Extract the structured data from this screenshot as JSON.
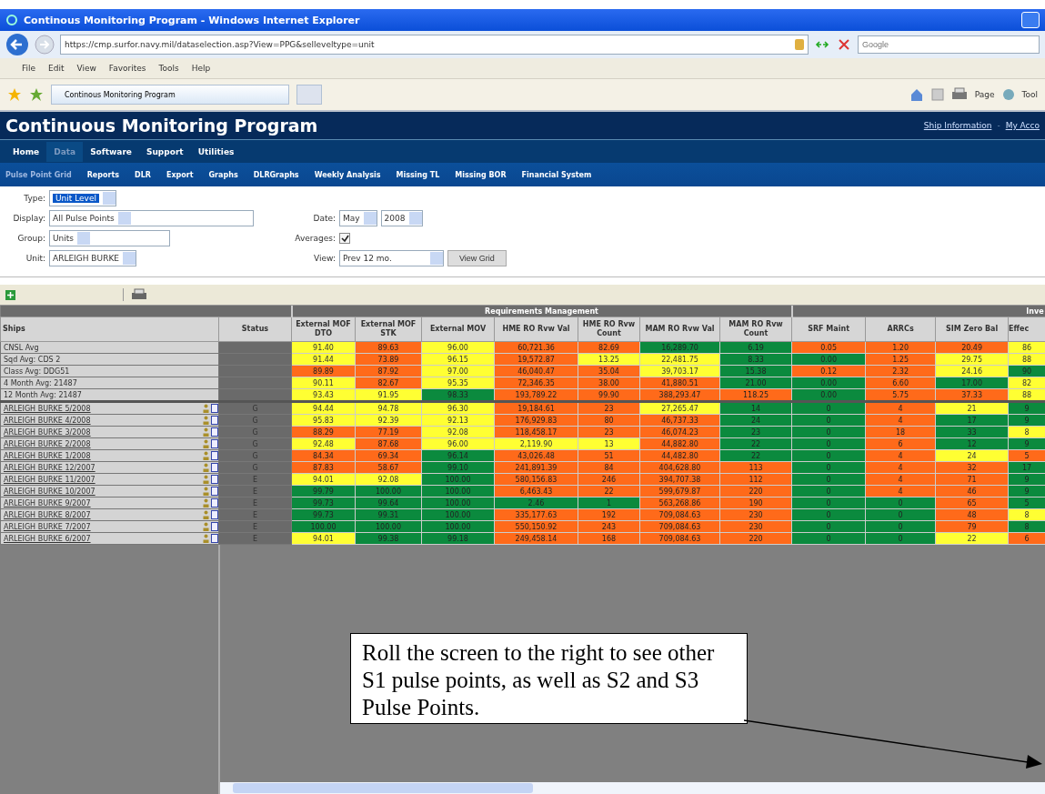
{
  "window": {
    "title": "Continous Monitoring Program - Windows Internet Explorer"
  },
  "address_bar": {
    "url": "https://cmp.surfor.navy.mil/dataselection.asp?View=PPG&selleveltype=unit"
  },
  "search": {
    "placeholder": "Google"
  },
  "menu_bar": [
    "File",
    "Edit",
    "View",
    "Favorites",
    "Tools",
    "Help"
  ],
  "browser_tab": {
    "title": "Continous Monitoring Program"
  },
  "command_bar": [
    "Page",
    "Tool"
  ],
  "app": {
    "title": "Continuous Monitoring Program",
    "header_links": [
      "Ship Information",
      "My Acco"
    ],
    "header_separator": "-"
  },
  "nav": [
    {
      "label": "Home",
      "selected": false
    },
    {
      "label": "Data",
      "selected": true
    },
    {
      "label": "Software",
      "selected": false
    },
    {
      "label": "Support",
      "selected": false
    },
    {
      "label": "Utilities",
      "selected": false
    }
  ],
  "subnav": [
    {
      "label": "Pulse Point Grid",
      "selected": true
    },
    {
      "label": "Reports",
      "selected": false
    },
    {
      "label": "DLR",
      "selected": false
    },
    {
      "label": "Export",
      "selected": false
    },
    {
      "label": "Graphs",
      "selected": false
    },
    {
      "label": "DLRGraphs",
      "selected": false
    },
    {
      "label": "Weekly Analysis",
      "selected": false
    },
    {
      "label": "Missing TL",
      "selected": false
    },
    {
      "label": "Missing BOR",
      "selected": false
    },
    {
      "label": "Financial System",
      "selected": false
    }
  ],
  "filters": {
    "type": {
      "label": "Type:",
      "value": "Unit Level"
    },
    "display": {
      "label": "Display:",
      "value": "All Pulse Points"
    },
    "group": {
      "label": "Group:",
      "value": "Units"
    },
    "unit": {
      "label": "Unit:",
      "value": "ARLEIGH BURKE"
    },
    "date": {
      "label": "Date:",
      "month": "May",
      "year": "2008"
    },
    "averages": {
      "label": "Averages:",
      "checked": true
    },
    "view": {
      "label": "View:",
      "value": "Prev 12 mo."
    },
    "button": "View Grid"
  },
  "table": {
    "groups": [
      "Requirements Management",
      "Inve"
    ],
    "row_header_columns": [
      "Ships",
      "Status"
    ],
    "columns": [
      "External MOF DTO",
      "External MOF STK",
      "External MOV",
      "HME RO Rvw Val",
      "HME RO Rvw Count",
      "MAM RO Rvw Val",
      "MAM RO Rvw Count",
      "SRF Maint",
      "ARRCs",
      "SIM Zero Bal",
      "Effec"
    ],
    "average_rows": [
      {
        "name": "CNSL Avg",
        "cells": [
          {
            "text": "91.40",
            "color": "#ffff33"
          },
          {
            "text": "89.63",
            "color": "#ff6a1a"
          },
          {
            "text": "96.00",
            "color": "#ffff33"
          },
          {
            "text": "60,721.36",
            "color": "#ff6a1a"
          },
          {
            "text": "82.69",
            "color": "#ff6a1a"
          },
          {
            "text": "16,289.70",
            "color": "#0b8a3e"
          },
          {
            "text": "6.19",
            "color": "#0b8a3e"
          },
          {
            "text": "0.05",
            "color": "#ff6a1a"
          },
          {
            "text": "1.20",
            "color": "#ff6a1a"
          },
          {
            "text": "20.49",
            "color": "#ff6a1a"
          },
          {
            "text": "86",
            "color": "#ffff33"
          }
        ]
      },
      {
        "name": "Sqd Avg: CDS 2",
        "cells": [
          {
            "text": "91.44",
            "color": "#ffff33"
          },
          {
            "text": "73.89",
            "color": "#ff6a1a"
          },
          {
            "text": "96.15",
            "color": "#ffff33"
          },
          {
            "text": "19,572.87",
            "color": "#ff6a1a"
          },
          {
            "text": "13.25",
            "color": "#ffff33"
          },
          {
            "text": "22,481.75",
            "color": "#ffff33"
          },
          {
            "text": "8.33",
            "color": "#0b8a3e"
          },
          {
            "text": "0.00",
            "color": "#0b8a3e"
          },
          {
            "text": "1.25",
            "color": "#ff6a1a"
          },
          {
            "text": "29.75",
            "color": "#ffff33"
          },
          {
            "text": "88",
            "color": "#ffff33"
          }
        ]
      },
      {
        "name": "Class Avg: DDG51",
        "cells": [
          {
            "text": "89.89",
            "color": "#ff6a1a"
          },
          {
            "text": "87.92",
            "color": "#ff6a1a"
          },
          {
            "text": "97.00",
            "color": "#ffff33"
          },
          {
            "text": "46,040.47",
            "color": "#ff6a1a"
          },
          {
            "text": "35.04",
            "color": "#ff6a1a"
          },
          {
            "text": "39,703.17",
            "color": "#ffff33"
          },
          {
            "text": "15.38",
            "color": "#0b8a3e"
          },
          {
            "text": "0.12",
            "color": "#ff6a1a"
          },
          {
            "text": "2.32",
            "color": "#ff6a1a"
          },
          {
            "text": "24.16",
            "color": "#ffff33"
          },
          {
            "text": "90",
            "color": "#0b8a3e"
          }
        ]
      },
      {
        "name": "4 Month Avg: 21487",
        "cells": [
          {
            "text": "90.11",
            "color": "#ffff33"
          },
          {
            "text": "82.67",
            "color": "#ff6a1a"
          },
          {
            "text": "95.35",
            "color": "#ffff33"
          },
          {
            "text": "72,346.35",
            "color": "#ff6a1a"
          },
          {
            "text": "38.00",
            "color": "#ff6a1a"
          },
          {
            "text": "41,880.51",
            "color": "#ff6a1a"
          },
          {
            "text": "21.00",
            "color": "#0b8a3e"
          },
          {
            "text": "0.00",
            "color": "#0b8a3e"
          },
          {
            "text": "6.60",
            "color": "#ff6a1a"
          },
          {
            "text": "17.00",
            "color": "#0b8a3e"
          },
          {
            "text": "82",
            "color": "#ffff33"
          }
        ]
      },
      {
        "name": "12 Month Avg: 21487",
        "cells": [
          {
            "text": "93.43",
            "color": "#ffff33"
          },
          {
            "text": "91.95",
            "color": "#ffff33"
          },
          {
            "text": "98.33",
            "color": "#0b8a3e"
          },
          {
            "text": "193,789.22",
            "color": "#ff6a1a"
          },
          {
            "text": "99.90",
            "color": "#ff6a1a"
          },
          {
            "text": "388,293.47",
            "color": "#ff6a1a"
          },
          {
            "text": "118.25",
            "color": "#ff6a1a"
          },
          {
            "text": "0.00",
            "color": "#0b8a3e"
          },
          {
            "text": "5.75",
            "color": "#ff6a1a"
          },
          {
            "text": "37.33",
            "color": "#ff6a1a"
          },
          {
            "text": "88",
            "color": "#ffff33"
          }
        ]
      }
    ],
    "rows": [
      {
        "name": "ARLEIGH BURKE 5/2008",
        "status": "G",
        "cells": [
          {
            "text": "94.44",
            "color": "#ffff33"
          },
          {
            "text": "94.78",
            "color": "#ffff33"
          },
          {
            "text": "96.30",
            "color": "#ffff33"
          },
          {
            "text": "19,184.61",
            "color": "#ff6a1a"
          },
          {
            "text": "23",
            "color": "#ff6a1a"
          },
          {
            "text": "27,265.47",
            "color": "#ffff33"
          },
          {
            "text": "14",
            "color": "#0b8a3e"
          },
          {
            "text": "0",
            "color": "#0b8a3e"
          },
          {
            "text": "4",
            "color": "#ff6a1a"
          },
          {
            "text": "21",
            "color": "#ffff33"
          },
          {
            "text": "9",
            "color": "#0b8a3e"
          }
        ]
      },
      {
        "name": "ARLEIGH BURKE 4/2008",
        "status": "G",
        "cells": [
          {
            "text": "95.83",
            "color": "#ffff33"
          },
          {
            "text": "92.39",
            "color": "#ffff33"
          },
          {
            "text": "92.13",
            "color": "#ffff33"
          },
          {
            "text": "176,929.83",
            "color": "#ff6a1a"
          },
          {
            "text": "80",
            "color": "#ff6a1a"
          },
          {
            "text": "46,737.33",
            "color": "#ff6a1a"
          },
          {
            "text": "24",
            "color": "#0b8a3e"
          },
          {
            "text": "0",
            "color": "#0b8a3e"
          },
          {
            "text": "4",
            "color": "#ff6a1a"
          },
          {
            "text": "17",
            "color": "#0b8a3e"
          },
          {
            "text": "9",
            "color": "#0b8a3e"
          }
        ]
      },
      {
        "name": "ARLEIGH BURKE 3/2008",
        "status": "G",
        "cells": [
          {
            "text": "88.29",
            "color": "#ff6a1a"
          },
          {
            "text": "77.19",
            "color": "#ff6a1a"
          },
          {
            "text": "92.08",
            "color": "#ffff33"
          },
          {
            "text": "118,458.17",
            "color": "#ff6a1a"
          },
          {
            "text": "23",
            "color": "#ff6a1a"
          },
          {
            "text": "46,074.23",
            "color": "#ff6a1a"
          },
          {
            "text": "23",
            "color": "#0b8a3e"
          },
          {
            "text": "0",
            "color": "#0b8a3e"
          },
          {
            "text": "18",
            "color": "#ff6a1a"
          },
          {
            "text": "33",
            "color": "#0b8a3e"
          },
          {
            "text": "8",
            "color": "#ffff33"
          }
        ]
      },
      {
        "name": "ARLEIGH BURKE 2/2008",
        "status": "G",
        "cells": [
          {
            "text": "92.48",
            "color": "#ffff33"
          },
          {
            "text": "87.68",
            "color": "#ff6a1a"
          },
          {
            "text": "96.00",
            "color": "#ffff33"
          },
          {
            "text": "2,119.90",
            "color": "#ffff33"
          },
          {
            "text": "13",
            "color": "#ffff33"
          },
          {
            "text": "44,882.80",
            "color": "#ff6a1a"
          },
          {
            "text": "22",
            "color": "#0b8a3e"
          },
          {
            "text": "0",
            "color": "#0b8a3e"
          },
          {
            "text": "6",
            "color": "#ff6a1a"
          },
          {
            "text": "12",
            "color": "#0b8a3e"
          },
          {
            "text": "9",
            "color": "#0b8a3e"
          }
        ]
      },
      {
        "name": "ARLEIGH BURKE 1/2008",
        "status": "G",
        "cells": [
          {
            "text": "84.34",
            "color": "#ff6a1a"
          },
          {
            "text": "69.34",
            "color": "#ff6a1a"
          },
          {
            "text": "96.14",
            "color": "#0b8a3e"
          },
          {
            "text": "43,026.48",
            "color": "#ff6a1a"
          },
          {
            "text": "51",
            "color": "#ff6a1a"
          },
          {
            "text": "44,482.80",
            "color": "#ff6a1a"
          },
          {
            "text": "22",
            "color": "#0b8a3e"
          },
          {
            "text": "0",
            "color": "#0b8a3e"
          },
          {
            "text": "4",
            "color": "#ff6a1a"
          },
          {
            "text": "24",
            "color": "#ffff33"
          },
          {
            "text": "5",
            "color": "#ff6a1a"
          }
        ]
      },
      {
        "name": "ARLEIGH BURKE 12/2007",
        "status": "G",
        "cells": [
          {
            "text": "87.83",
            "color": "#ff6a1a"
          },
          {
            "text": "58.67",
            "color": "#ff6a1a"
          },
          {
            "text": "99.10",
            "color": "#0b8a3e"
          },
          {
            "text": "241,891.39",
            "color": "#ff6a1a"
          },
          {
            "text": "84",
            "color": "#ff6a1a"
          },
          {
            "text": "404,628.80",
            "color": "#ff6a1a"
          },
          {
            "text": "113",
            "color": "#ff6a1a"
          },
          {
            "text": "0",
            "color": "#0b8a3e"
          },
          {
            "text": "4",
            "color": "#ff6a1a"
          },
          {
            "text": "32",
            "color": "#ff6a1a"
          },
          {
            "text": "17",
            "color": "#0b8a3e"
          }
        ]
      },
      {
        "name": "ARLEIGH BURKE 11/2007",
        "status": "E",
        "cells": [
          {
            "text": "94.01",
            "color": "#ffff33"
          },
          {
            "text": "92.08",
            "color": "#ffff33"
          },
          {
            "text": "100.00",
            "color": "#0b8a3e"
          },
          {
            "text": "580,156.83",
            "color": "#ff6a1a"
          },
          {
            "text": "246",
            "color": "#ff6a1a"
          },
          {
            "text": "394,707.38",
            "color": "#ff6a1a"
          },
          {
            "text": "112",
            "color": "#ff6a1a"
          },
          {
            "text": "0",
            "color": "#0b8a3e"
          },
          {
            "text": "4",
            "color": "#ff6a1a"
          },
          {
            "text": "71",
            "color": "#ff6a1a"
          },
          {
            "text": "9",
            "color": "#0b8a3e"
          }
        ]
      },
      {
        "name": "ARLEIGH BURKE 10/2007",
        "status": "E",
        "cells": [
          {
            "text": "99.79",
            "color": "#0b8a3e"
          },
          {
            "text": "100.00",
            "color": "#0b8a3e"
          },
          {
            "text": "100.00",
            "color": "#0b8a3e"
          },
          {
            "text": "6,463.43",
            "color": "#ff6a1a"
          },
          {
            "text": "22",
            "color": "#ff6a1a"
          },
          {
            "text": "599,679.87",
            "color": "#ff6a1a"
          },
          {
            "text": "220",
            "color": "#ff6a1a"
          },
          {
            "text": "0",
            "color": "#0b8a3e"
          },
          {
            "text": "4",
            "color": "#ff6a1a"
          },
          {
            "text": "46",
            "color": "#ff6a1a"
          },
          {
            "text": "9",
            "color": "#0b8a3e"
          }
        ]
      },
      {
        "name": "ARLEIGH BURKE 9/2007",
        "status": "E",
        "cells": [
          {
            "text": "99.73",
            "color": "#0b8a3e"
          },
          {
            "text": "99.64",
            "color": "#0b8a3e"
          },
          {
            "text": "100.00",
            "color": "#0b8a3e"
          },
          {
            "text": "2.46",
            "color": "#0b8a3e"
          },
          {
            "text": "1",
            "color": "#0b8a3e"
          },
          {
            "text": "563,268.86",
            "color": "#ff6a1a"
          },
          {
            "text": "190",
            "color": "#ff6a1a"
          },
          {
            "text": "0",
            "color": "#0b8a3e"
          },
          {
            "text": "0",
            "color": "#0b8a3e"
          },
          {
            "text": "65",
            "color": "#ff6a1a"
          },
          {
            "text": "5",
            "color": "#0b8a3e"
          }
        ]
      },
      {
        "name": "ARLEIGH BURKE 8/2007",
        "status": "E",
        "cells": [
          {
            "text": "99.73",
            "color": "#0b8a3e"
          },
          {
            "text": "99.31",
            "color": "#0b8a3e"
          },
          {
            "text": "100.00",
            "color": "#0b8a3e"
          },
          {
            "text": "335,177.63",
            "color": "#ff6a1a"
          },
          {
            "text": "192",
            "color": "#ff6a1a"
          },
          {
            "text": "709,084.63",
            "color": "#ff6a1a"
          },
          {
            "text": "230",
            "color": "#ff6a1a"
          },
          {
            "text": "0",
            "color": "#0b8a3e"
          },
          {
            "text": "0",
            "color": "#0b8a3e"
          },
          {
            "text": "48",
            "color": "#ff6a1a"
          },
          {
            "text": "8",
            "color": "#ffff33"
          }
        ]
      },
      {
        "name": "ARLEIGH BURKE 7/2007",
        "status": "E",
        "cells": [
          {
            "text": "100.00",
            "color": "#0b8a3e"
          },
          {
            "text": "100.00",
            "color": "#0b8a3e"
          },
          {
            "text": "100.00",
            "color": "#0b8a3e"
          },
          {
            "text": "550,150.92",
            "color": "#ff6a1a"
          },
          {
            "text": "243",
            "color": "#ff6a1a"
          },
          {
            "text": "709,084.63",
            "color": "#ff6a1a"
          },
          {
            "text": "230",
            "color": "#ff6a1a"
          },
          {
            "text": "0",
            "color": "#0b8a3e"
          },
          {
            "text": "0",
            "color": "#0b8a3e"
          },
          {
            "text": "79",
            "color": "#ff6a1a"
          },
          {
            "text": "8",
            "color": "#0b8a3e"
          }
        ]
      },
      {
        "name": "ARLEIGH BURKE 6/2007",
        "status": "E",
        "cells": [
          {
            "text": "94.01",
            "color": "#ffff33"
          },
          {
            "text": "99.38",
            "color": "#0b8a3e"
          },
          {
            "text": "99.18",
            "color": "#0b8a3e"
          },
          {
            "text": "249,458.14",
            "color": "#ff6a1a"
          },
          {
            "text": "168",
            "color": "#ff6a1a"
          },
          {
            "text": "709,084.63",
            "color": "#ff6a1a"
          },
          {
            "text": "220",
            "color": "#ff6a1a"
          },
          {
            "text": "0",
            "color": "#0b8a3e"
          },
          {
            "text": "0",
            "color": "#0b8a3e"
          },
          {
            "text": "22",
            "color": "#ffff33"
          },
          {
            "text": "6",
            "color": "#ff6a1a"
          }
        ]
      }
    ]
  },
  "callout": {
    "text": "Roll the screen to the right to see other S1 pulse points, as well as S2 and S3 Pulse Points."
  }
}
